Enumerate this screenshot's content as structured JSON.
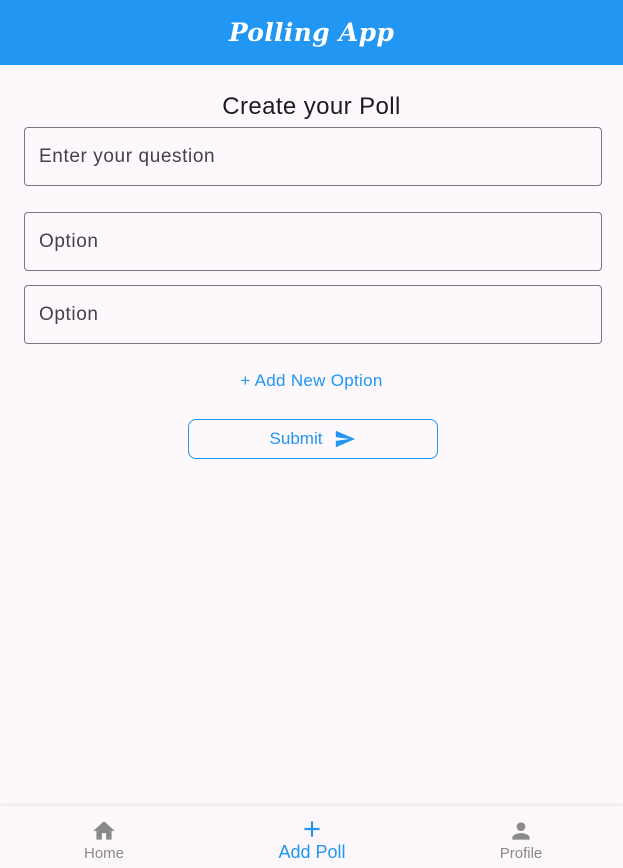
{
  "app_bar": {
    "title": "Polling App"
  },
  "form": {
    "heading": "Create your Poll",
    "question_placeholder": "Enter your question",
    "option_placeholders": [
      "Option",
      "Option"
    ],
    "add_option_label": "+ Add New Option",
    "submit_label": "Submit",
    "submit_icon": "send-icon"
  },
  "bottom_nav": {
    "items": [
      {
        "label": "Home",
        "icon": "home-icon",
        "active": false
      },
      {
        "label": "Add Poll",
        "icon": "plus-icon",
        "active": true
      },
      {
        "label": "Profile",
        "icon": "person-icon",
        "active": false
      }
    ]
  },
  "colors": {
    "primary": "#2196f3",
    "background": "#fcf8fc",
    "outline": "#7a757f",
    "inactive": "#8a8a8a"
  }
}
